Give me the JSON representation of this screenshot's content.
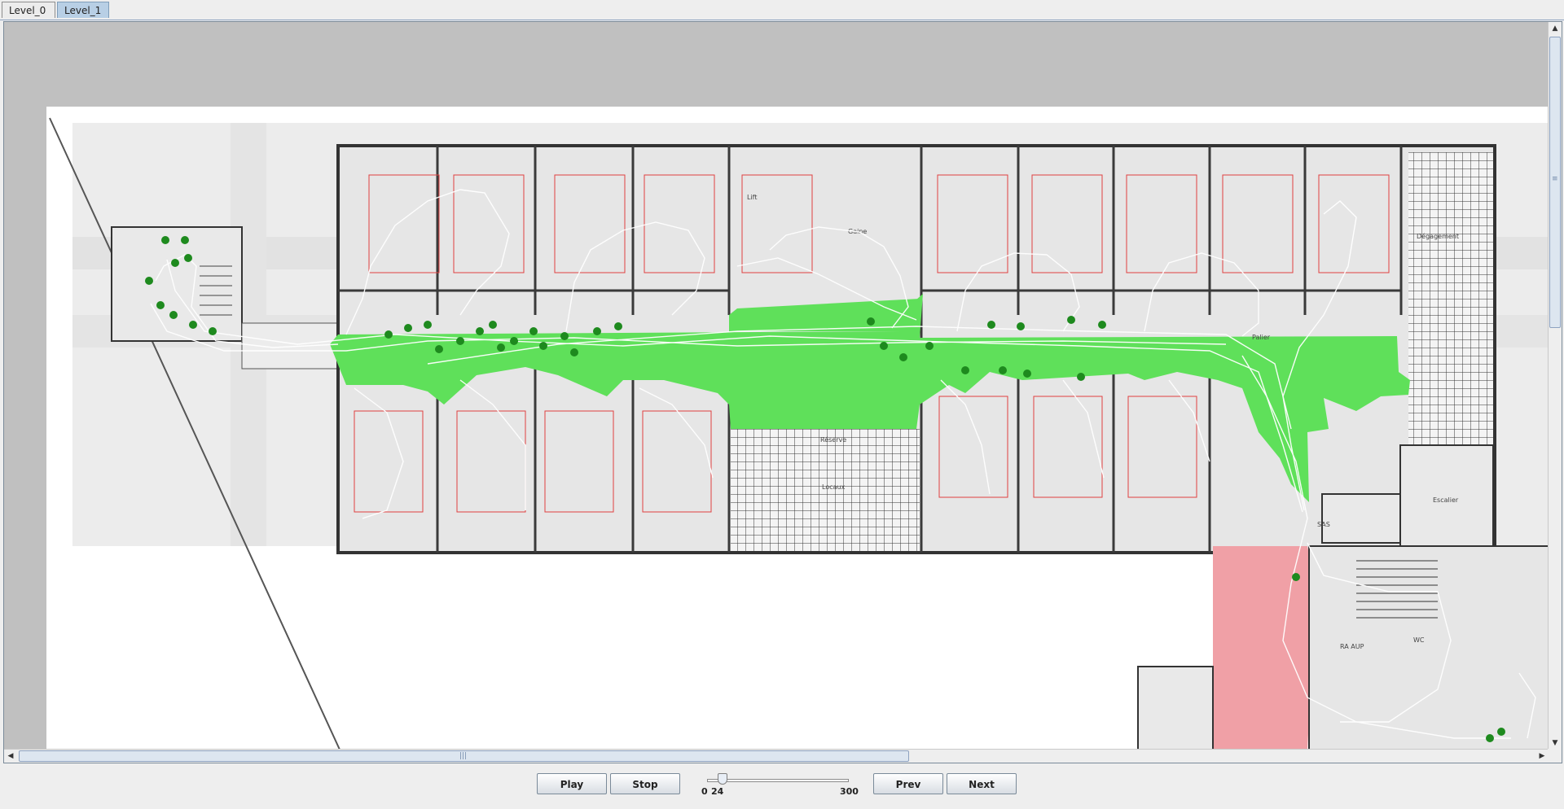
{
  "tabs": [
    {
      "label": "Level_0",
      "active": false
    },
    {
      "label": "Level_1",
      "active": true
    }
  ],
  "controls": {
    "play_label": "Play",
    "stop_label": "Stop",
    "prev_label": "Prev",
    "next_label": "Next",
    "slider_min_label": "0",
    "slider_current_label": "24",
    "slider_max_label": "300",
    "slider_value": 24,
    "slider_max": 300
  },
  "plan": {
    "room_labels": {
      "label_a": "Lift",
      "label_b": "Gaine",
      "label_c": "Réserve",
      "label_d": "Locaux",
      "label_e": "Dégagement",
      "label_f": "Palier",
      "label_g": "SAS",
      "label_h": "Escalier",
      "label_i": "RA AUP",
      "label_j": "WC"
    }
  },
  "colors": {
    "corridor_green": "#5fe05a",
    "exit_red": "#f0a0a6",
    "agent_dot": "#1e8a1e",
    "trajectory": "#ffffff",
    "room_outline": "#e04040"
  },
  "icons": {
    "scroll_up": "arrow-up-icon",
    "scroll_down": "arrow-down-icon",
    "scroll_left": "arrow-left-icon",
    "scroll_right": "arrow-right-icon"
  }
}
